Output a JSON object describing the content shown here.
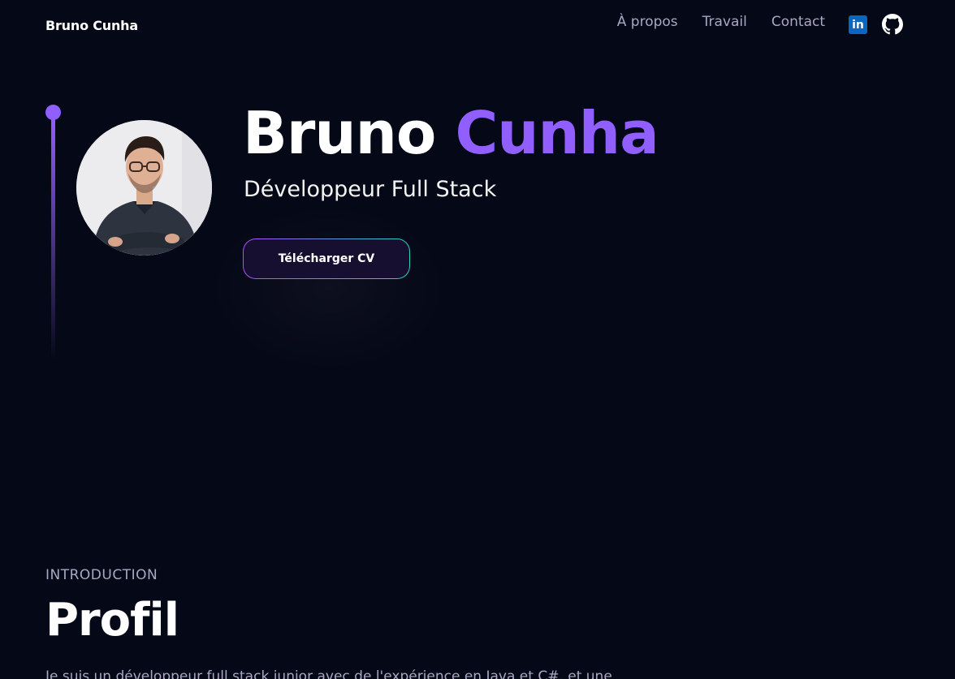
{
  "header": {
    "brand": "Bruno Cunha",
    "nav": [
      {
        "label": "À propos"
      },
      {
        "label": "Travail"
      },
      {
        "label": "Contact"
      }
    ],
    "socials": {
      "linkedin_icon": "linkedin-icon",
      "linkedin_text": "in",
      "github_icon": "github-icon"
    }
  },
  "hero": {
    "first_name": "Bruno",
    "last_name": "Cunha",
    "subtitle": "Développeur Full Stack",
    "cv_button": "Télécharger CV",
    "avatar": "profile-photo"
  },
  "profile": {
    "subtitle": "INTRODUCTION",
    "title": "Profil",
    "text": "Je suis un développeur full stack junior avec de l'expérience en Java et C#, et une"
  },
  "colors": {
    "background": "#050816",
    "accent": "#915eff",
    "secondary_text": "#aaa6c3",
    "linkedin": "#0a66c2"
  }
}
